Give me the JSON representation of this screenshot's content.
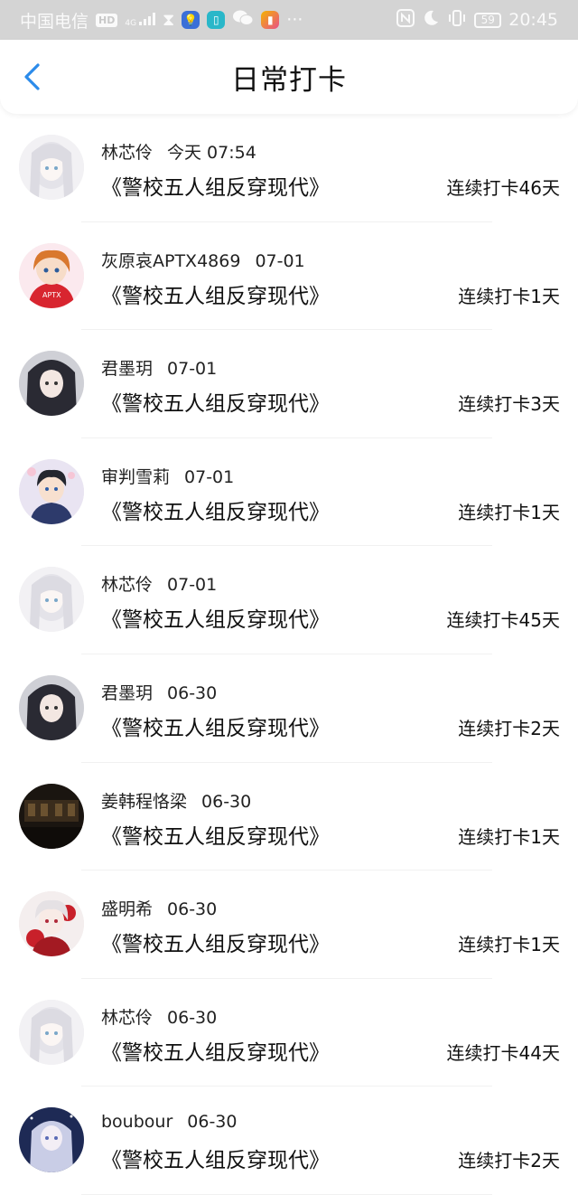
{
  "status_bar": {
    "carrier": "中国电信",
    "hd": "HD",
    "signal": "4G",
    "battery": "59",
    "time": "20:45",
    "icons": [
      "hourglass-icon",
      "bulb-app-icon",
      "book-app-icon",
      "wechat-icon",
      "app-icon",
      "more-icon",
      "nfc-icon",
      "moon-icon",
      "vibrate-icon"
    ]
  },
  "header": {
    "title": "日常打卡",
    "back_icon": "chevron-left-icon",
    "accent": "#2b8bea"
  },
  "entries": [
    {
      "name": "林芯伶",
      "time": "今天 07:54",
      "book": "《警校五人组反穿现代》",
      "streak": "连续打卡46天",
      "avatar": "white-hair-girl"
    },
    {
      "name": "灰原哀APTX4869",
      "time": "07-01",
      "book": "《警校五人组反穿现代》",
      "streak": "连续打卡1天",
      "avatar": "red-hoodie-girl"
    },
    {
      "name": "君墨玥",
      "time": "07-01",
      "book": "《警校五人组反穿现代》",
      "streak": "连续打卡3天",
      "avatar": "dark-hair-girl"
    },
    {
      "name": "审判雪莉",
      "time": "07-01",
      "book": "《警校五人组反穿现代》",
      "streak": "连续打卡1天",
      "avatar": "boy-suit"
    },
    {
      "name": "林芯伶",
      "time": "07-01",
      "book": "《警校五人组反穿现代》",
      "streak": "连续打卡45天",
      "avatar": "white-hair-girl"
    },
    {
      "name": "君墨玥",
      "time": "06-30",
      "book": "《警校五人组反穿现代》",
      "streak": "连续打卡2天",
      "avatar": "dark-hair-girl"
    },
    {
      "name": "姜韩程恪梁",
      "time": "06-30",
      "book": "《警校五人组反穿现代》",
      "streak": "连续打卡1天",
      "avatar": "dark-room"
    },
    {
      "name": "盛明希",
      "time": "06-30",
      "book": "《警校五人组反穿现代》",
      "streak": "连续打卡1天",
      "avatar": "red-flower-girl"
    },
    {
      "name": "林芯伶",
      "time": "06-30",
      "book": "《警校五人组反穿现代》",
      "streak": "连续打卡44天",
      "avatar": "white-hair-girl"
    },
    {
      "name": "boubour",
      "time": "06-30",
      "book": "《警校五人组反穿现代》",
      "streak": "连续打卡2天",
      "avatar": "blue-night-girl"
    }
  ]
}
